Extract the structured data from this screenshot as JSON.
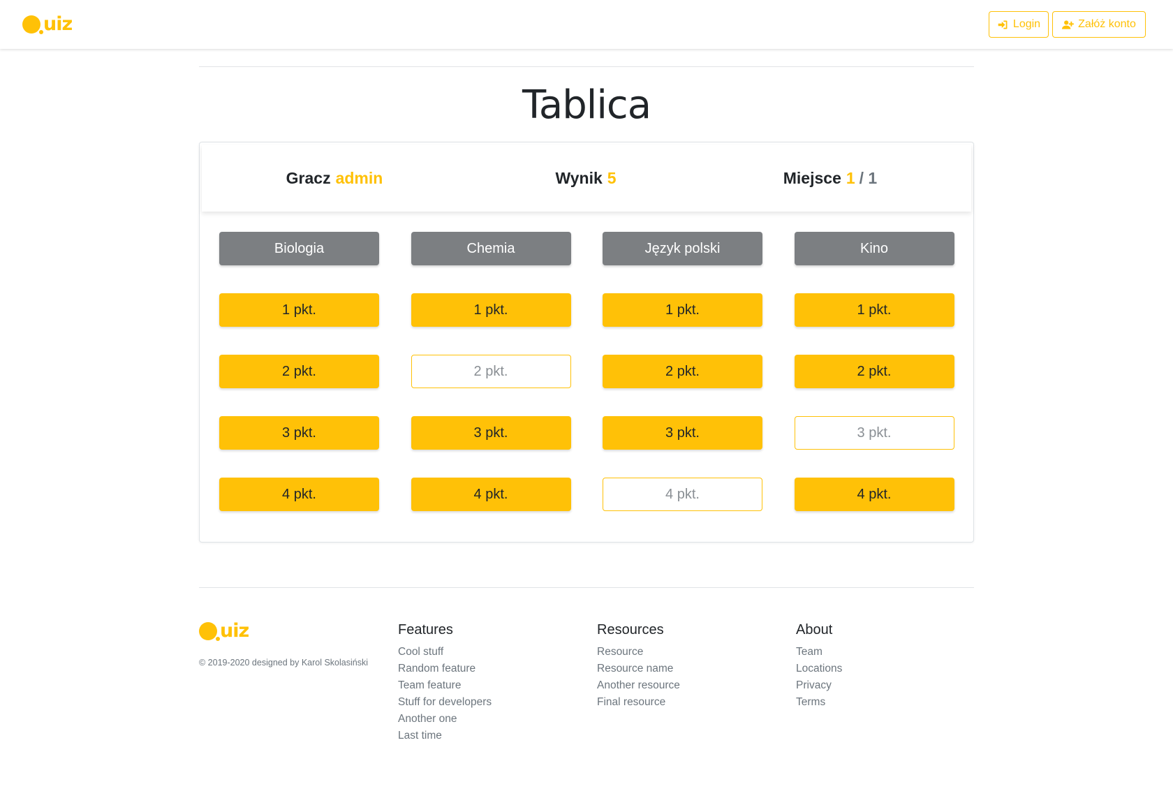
{
  "brand": {
    "logo_text": "uiz",
    "logo_alt": "Quiz",
    "accent_color": "#ffc107"
  },
  "nav": {
    "login_label": "Login",
    "register_label": "Załóż konto",
    "login_icon": "sign-in-icon",
    "register_icon": "user-plus-icon"
  },
  "page_title": "Tablica",
  "stats": {
    "player_label": "Gracz",
    "player_value": "admin",
    "score_label": "Wynik",
    "score_value": "5",
    "place_label": "Miejsce",
    "place_value": "1",
    "place_total": "/ 1"
  },
  "board": {
    "categories": [
      {
        "name": "Biologia",
        "questions": [
          {
            "label": "1 pkt.",
            "used": false
          },
          {
            "label": "2 pkt.",
            "used": false
          },
          {
            "label": "3 pkt.",
            "used": false
          },
          {
            "label": "4 pkt.",
            "used": false
          }
        ]
      },
      {
        "name": "Chemia",
        "questions": [
          {
            "label": "1 pkt.",
            "used": false
          },
          {
            "label": "2 pkt.",
            "used": true
          },
          {
            "label": "3 pkt.",
            "used": false
          },
          {
            "label": "4 pkt.",
            "used": false
          }
        ]
      },
      {
        "name": "Język polski",
        "questions": [
          {
            "label": "1 pkt.",
            "used": false
          },
          {
            "label": "2 pkt.",
            "used": false
          },
          {
            "label": "3 pkt.",
            "used": false
          },
          {
            "label": "4 pkt.",
            "used": true
          }
        ]
      },
      {
        "name": "Kino",
        "questions": [
          {
            "label": "1 pkt.",
            "used": false
          },
          {
            "label": "2 pkt.",
            "used": false
          },
          {
            "label": "3 pkt.",
            "used": true
          },
          {
            "label": "4 pkt.",
            "used": false
          }
        ]
      }
    ]
  },
  "footer": {
    "copyright": "© 2019-2020 designed by Karol Skolasiński",
    "columns": [
      {
        "title": "Features",
        "links": [
          "Cool stuff",
          "Random feature",
          "Team feature",
          "Stuff for developers",
          "Another one",
          "Last time"
        ]
      },
      {
        "title": "Resources",
        "links": [
          "Resource",
          "Resource name",
          "Another resource",
          "Final resource"
        ]
      },
      {
        "title": "About",
        "links": [
          "Team",
          "Locations",
          "Privacy",
          "Terms"
        ]
      }
    ]
  }
}
